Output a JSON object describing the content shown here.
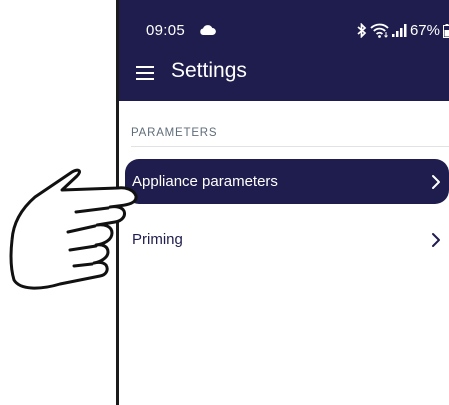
{
  "status_bar": {
    "time": "09:05",
    "battery": "67%",
    "icons": [
      "cloud-icon",
      "bluetooth-icon",
      "wifi-icon",
      "signal-icon",
      "battery-icon"
    ]
  },
  "app_bar": {
    "title": "Settings",
    "menu_icon": "hamburger-menu-icon"
  },
  "section": {
    "header": "PARAMETERS"
  },
  "items": [
    {
      "label": "Appliance parameters",
      "icon": "chevron-right-icon",
      "selected": true
    },
    {
      "label": "Priming",
      "icon": "chevron-right-icon",
      "selected": false
    }
  ],
  "colors": {
    "primary": "#1f1d4d",
    "text_primary": "#1f1d4d",
    "section_header": "#5f6d7a",
    "background": "#ffffff"
  }
}
